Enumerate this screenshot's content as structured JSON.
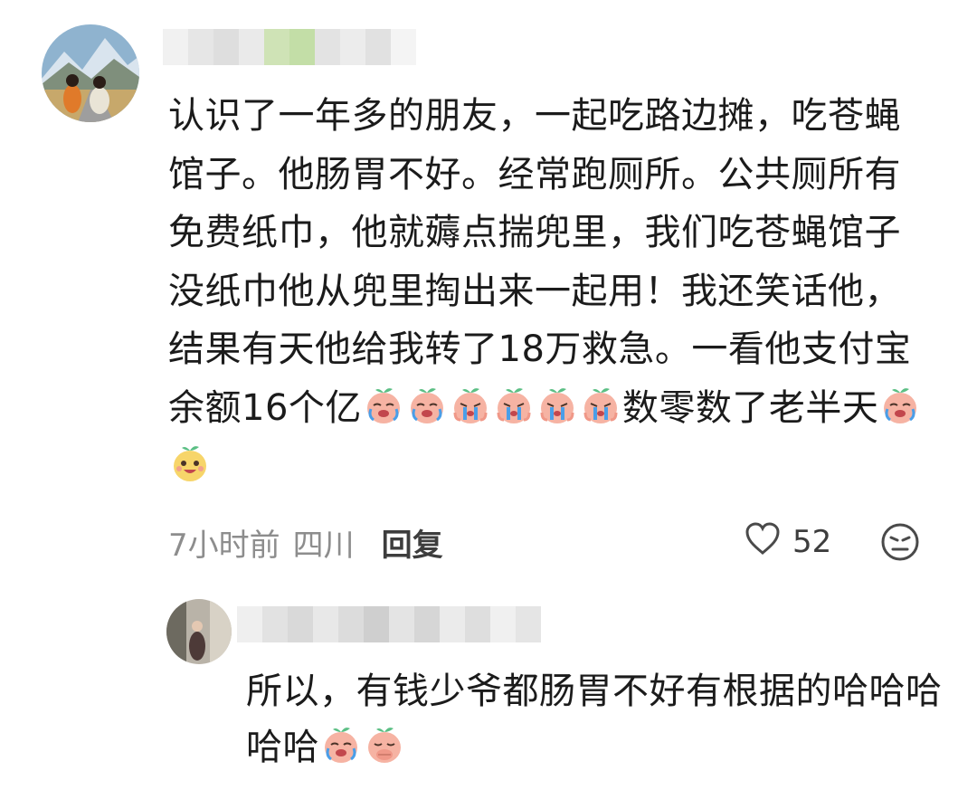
{
  "comment": {
    "author_name": "",
    "text_part1": "认识了一年多的朋友，一起吃路边摊，吃苍蝇馆子。他肠胃不好。经常跑厕所。公共厕所有免费纸巾，他就薅点揣兜里，我们吃苍蝇馆子没纸巾他从兜里掏出来一起用！我还笑话他，结果有天他给我转了18万救急。一看他支付宝余额16个亿",
    "text_part2": "数零数了老半天",
    "emojis_part1": [
      "crying-face",
      "crying-face",
      "sobbing-face",
      "sobbing-face",
      "sobbing-face",
      "sobbing-face"
    ],
    "emojis_part2": [
      "crying-face",
      "laughing-face"
    ],
    "time": "7小时前",
    "location": "四川",
    "reply_label": "回复",
    "like_count": "52"
  },
  "reply": {
    "author_name": "",
    "text": "所以，有钱少爷都肠胃不好有根据的哈哈哈哈哈",
    "emojis": [
      "crying-face",
      "covering-mouth-face"
    ]
  },
  "colors": {
    "emoji_body": "#f6b3a3",
    "emoji_leaf": "#5bbf84",
    "tears": "#4a9ee8",
    "meta_text": "#8d8d8d"
  }
}
